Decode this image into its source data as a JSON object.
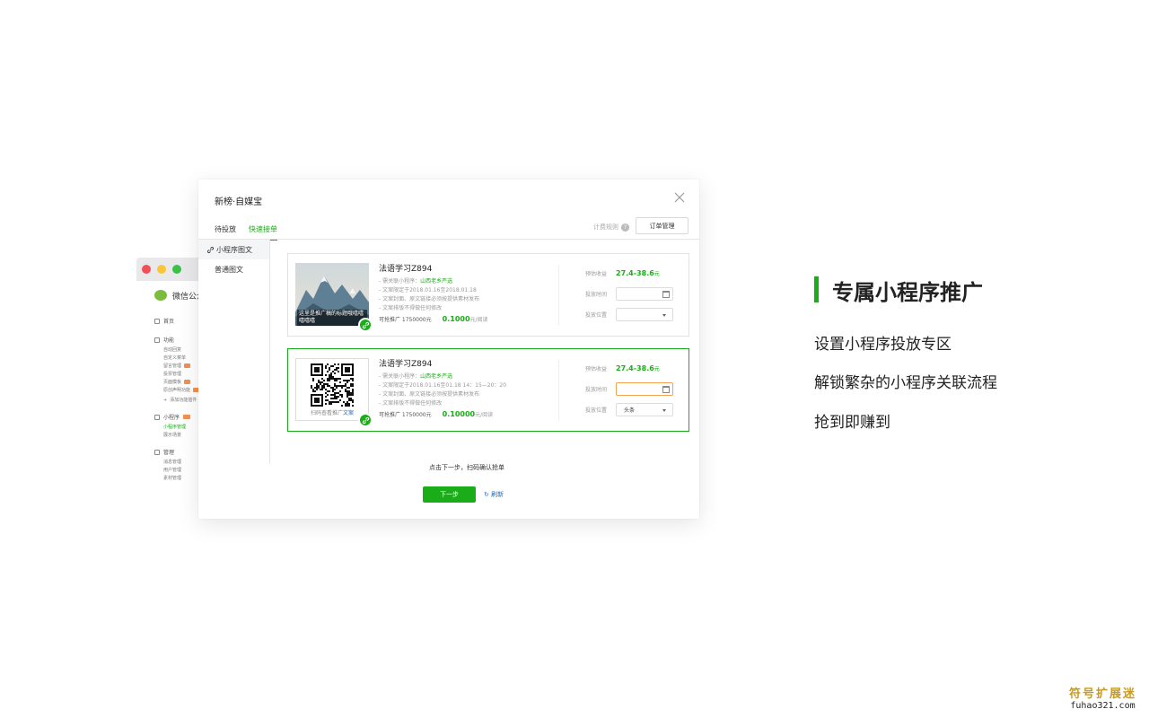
{
  "bg_window": {
    "app_name": "微信公众",
    "sections": [
      {
        "label": "首页",
        "items": []
      },
      {
        "label": "功能",
        "items": [
          "自动回复",
          "自定义菜单",
          "留言管理",
          "投票管理",
          "页面模板",
          "原创声明功能",
          "添加功能插件"
        ]
      },
      {
        "label": "小程序",
        "items": [
          "小程序管理",
          "展示场景"
        ]
      },
      {
        "label": "管理",
        "items": [
          "消息管理",
          "用户管理",
          "素材管理"
        ]
      }
    ]
  },
  "dialog": {
    "title": "新榜·自媒宝",
    "tabs": [
      "待投放",
      "快速接单"
    ],
    "rule_link": "计费规则",
    "order_button": "订单管理",
    "side_nav": [
      "小程序图文",
      "普通图文"
    ],
    "cards": [
      {
        "title": "法语学习Z894",
        "image_caption": "这里是推广稿的标题哦嘻嘻嘻嘻嘻",
        "lines": [
          "- 需关联小程序：",
          "- 文案限定于2018.01.16至2018.01.18",
          "- 文案封面、原文链接必须按提供素材发布",
          "- 文案排版不得做任何修改"
        ],
        "mini_program": "山西老乡严选",
        "available": "可抢推广 1750000元",
        "price": "0.1000",
        "price_unit": "元/阅读",
        "est_label": "预估收益",
        "est_range": "27.4-38.6",
        "est_unit": "元",
        "time_label": "投放时间",
        "pos_label": "投放位置",
        "pos_value": ""
      },
      {
        "title": "法语学习Z894",
        "qr_caption": "扫码查看推广",
        "qr_caption_link": "文案",
        "lines": [
          "- 需关联小程序：",
          "- 文案限定于2018.01.16至01.18  14：15—20：20",
          "- 文案封面、原文链接必须按提供素材发布",
          "- 文案排版不得做任何修改"
        ],
        "mini_program": "山西老乡严选",
        "available": "可抢推广 1750000元",
        "price": "0.10000",
        "price_unit": "元/阅读",
        "est_label": "预估收益",
        "est_range": "27.4-38.6",
        "est_unit": "元",
        "time_label": "投放时间",
        "pos_label": "投放位置",
        "pos_value": "头条"
      }
    ],
    "hint": "点击下一步，扫码确认抢单",
    "next_button": "下一步",
    "refresh": "刷新"
  },
  "feature": {
    "title": "专属小程序推广",
    "lines": [
      "设置小程序投放专区",
      "解锁繁杂的小程序关联流程",
      "抢到即赚到"
    ]
  },
  "watermark": {
    "cn": "符号扩展迷",
    "en": "fuhao321.com"
  },
  "colors": {
    "accent": "#1aad19",
    "link": "#1a6bbf",
    "focus": "#f3a34f",
    "watermark": "#c99a1c"
  }
}
